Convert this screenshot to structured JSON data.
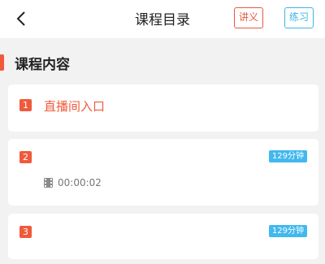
{
  "header": {
    "title": "课程目录",
    "notes_label": "讲义",
    "practice_label": "练习"
  },
  "section": {
    "title": "课程内容"
  },
  "lessons": [
    {
      "number": "1",
      "title": "直播间入口",
      "duration": "",
      "play_time": ""
    },
    {
      "number": "2",
      "title": "",
      "duration": "129分钟",
      "play_time": "00:00:02"
    },
    {
      "number": "3",
      "title": "",
      "duration": "129分钟",
      "play_time": ""
    }
  ],
  "colors": {
    "accent": "#f05a3c",
    "notes_border": "#e8593c",
    "practice_border": "#3cb6e6",
    "duration_badge": "#42b8ee",
    "background": "#f2f2f2"
  },
  "icons": {
    "back": "chevron-left-icon",
    "video": "film-icon"
  }
}
